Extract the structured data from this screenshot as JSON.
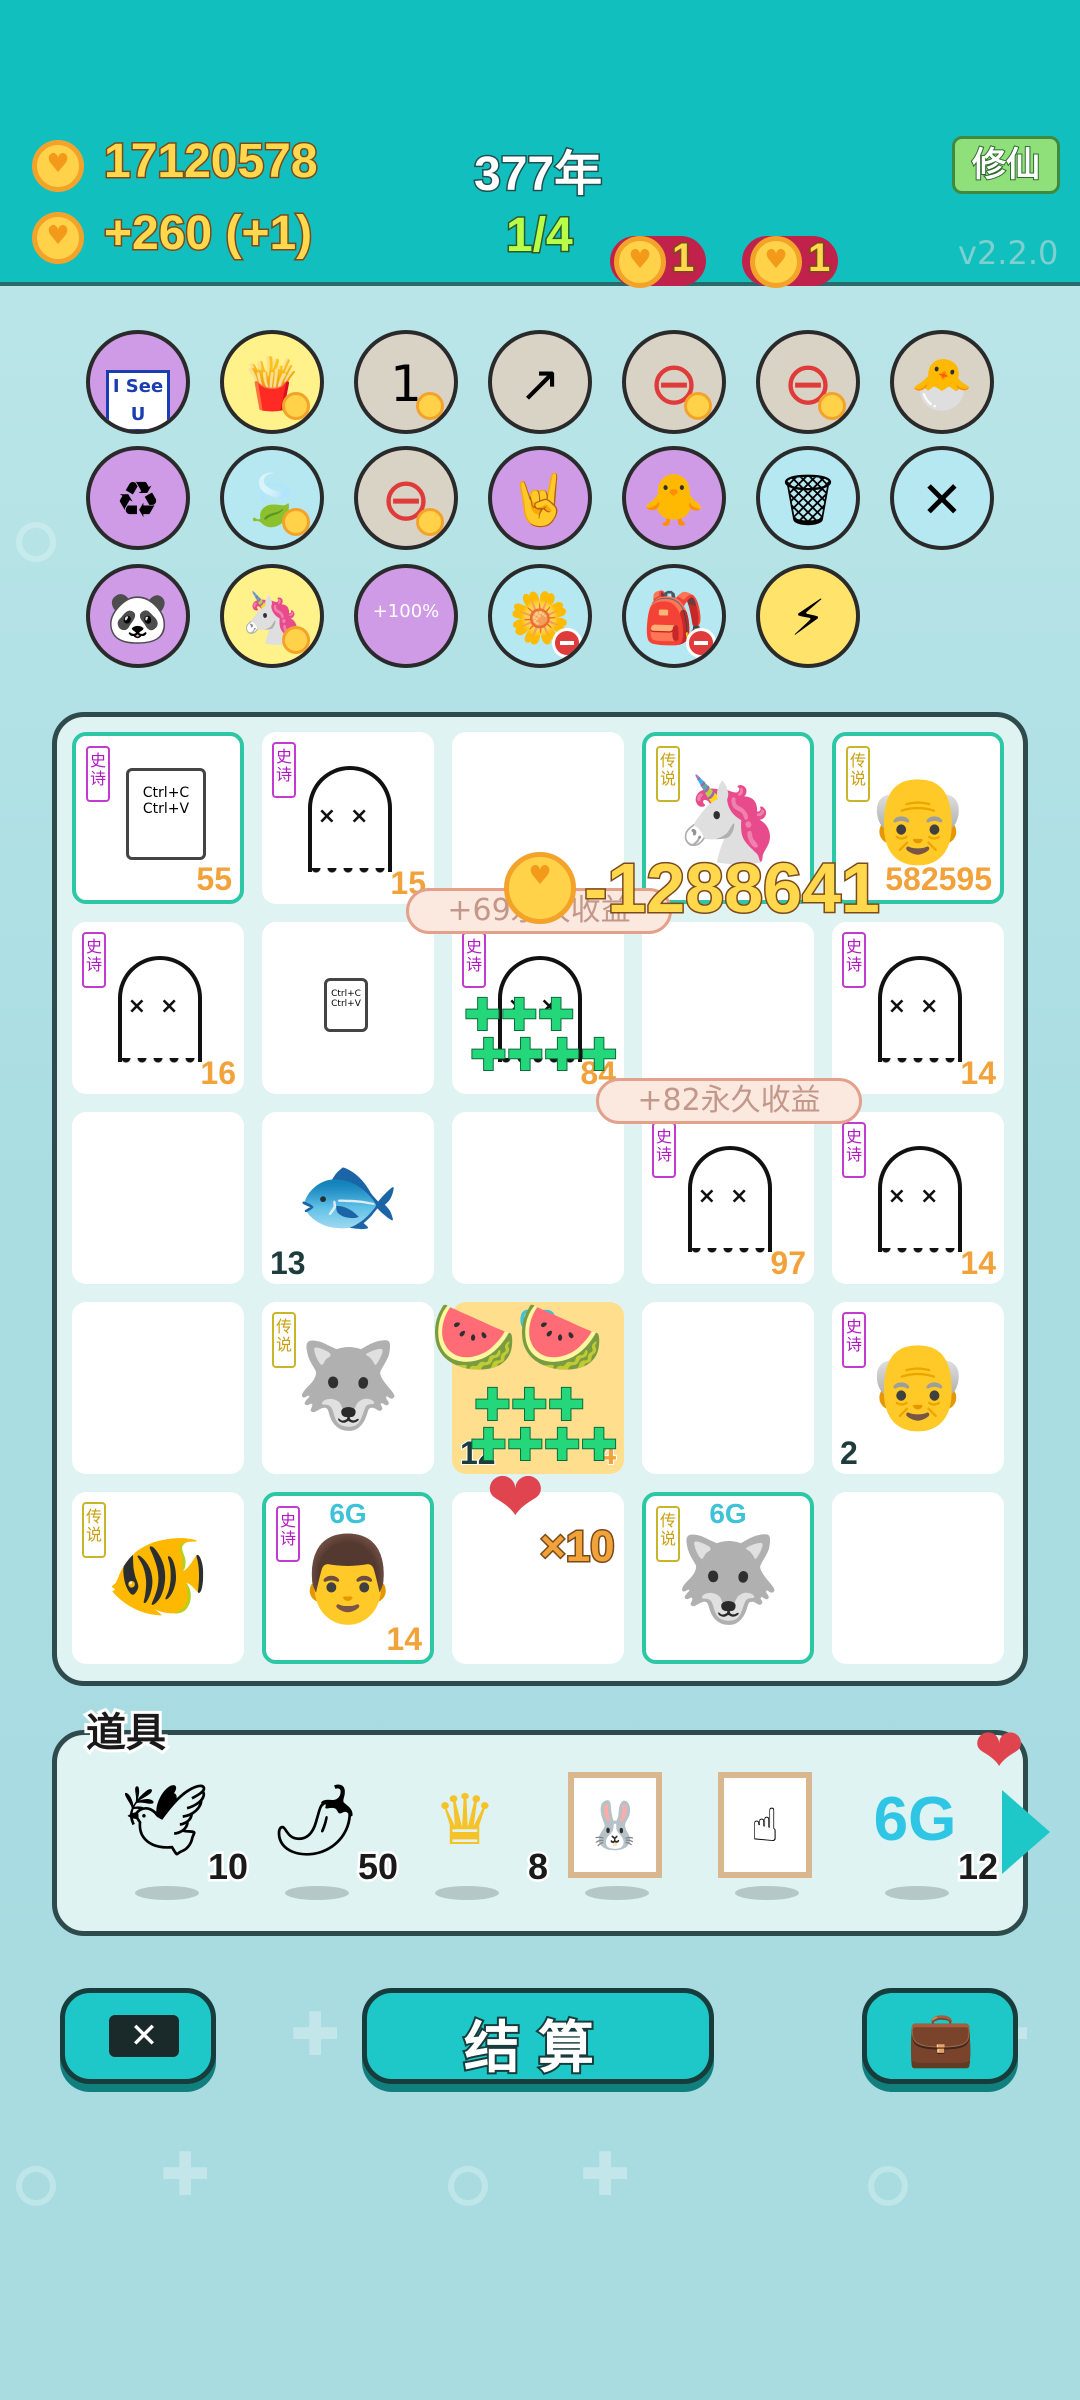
{
  "header": {
    "coins": "17120578",
    "income": "+260 (+1)",
    "years": "377年",
    "progress": "1/4",
    "badge1": "1",
    "badge2": "1",
    "xiuxian_button": "修仙",
    "version": "v2.2.0"
  },
  "skills": [
    {
      "icon": "i-see-u-icon",
      "label": "I See U",
      "color": "#cf9be6"
    },
    {
      "icon": "fries-icon",
      "label": "🍟",
      "color": "#fff28a"
    },
    {
      "icon": "coin-hands-icon",
      "label": "1",
      "color": "#d9d3c6"
    },
    {
      "icon": "arrow-up-icon",
      "label": "↗",
      "color": "#d9d3c6"
    },
    {
      "icon": "no-entry-icon",
      "label": "⊖",
      "color": "#d9d3c6"
    },
    {
      "icon": "no-entry-icon",
      "label": "⊖",
      "color": "#d9d3c6"
    },
    {
      "icon": "chick-egg-icon",
      "label": "🐣",
      "color": "#d9d3c6"
    },
    {
      "icon": "recycle-icon",
      "label": "♻",
      "color": "#cf9be6"
    },
    {
      "icon": "leaf-icon",
      "label": "🍃",
      "color": "#b6e8f2"
    },
    {
      "icon": "no-entry-icon",
      "label": "⊖",
      "color": "#d9d3c6"
    },
    {
      "icon": "rock-hand-icon",
      "label": "🤘",
      "color": "#cf9be6"
    },
    {
      "icon": "chicks-icon",
      "label": "🐥",
      "color": "#cf9be6"
    },
    {
      "icon": "trash-bag-icon",
      "label": "🗑",
      "color": "#b6e8f2"
    },
    {
      "icon": "sticks-icon",
      "label": "✕",
      "color": "#b6e8f2"
    },
    {
      "icon": "panda-icon",
      "label": "🐼",
      "color": "#cf9be6"
    },
    {
      "icon": "unicorn-icon",
      "label": "🦄",
      "color": "#fff28a"
    },
    {
      "icon": "bucket-icon",
      "label": "+100%",
      "color": "#cf9be6"
    },
    {
      "icon": "flower-pot-icon",
      "label": "🌼",
      "color": "#b6e8f2"
    },
    {
      "icon": "bag-icon",
      "label": "🎒",
      "color": "#b6e8f2"
    },
    {
      "icon": "lightning-icon",
      "label": "⚡",
      "color": "#ffe36b"
    }
  ],
  "board": {
    "cells": [
      {
        "tag": "史诗",
        "num": "55"
      },
      {
        "tag": "史诗",
        "num": "15"
      },
      {
        "tag": "",
        "num": ""
      },
      {
        "tag": "传说",
        "num": ""
      },
      {
        "tag": "传说",
        "num": "582595"
      },
      {
        "tag": "史诗",
        "num": "16"
      },
      {
        "tag": "",
        "num": ""
      },
      {
        "tag": "史诗",
        "num": "84"
      },
      {
        "tag": "",
        "num": ""
      },
      {
        "tag": "史诗",
        "num": "14"
      },
      {
        "tag": "",
        "num": ""
      },
      {
        "tag": "",
        "num": "13"
      },
      {
        "tag": "",
        "num": ""
      },
      {
        "tag": "史诗",
        "num": "97"
      },
      {
        "tag": "史诗",
        "num": "14"
      },
      {
        "tag": "",
        "num": ""
      },
      {
        "tag": "传说",
        "num": ""
      },
      {
        "tag": "",
        "num": "12",
        "g6": "6G",
        "num2": "4"
      },
      {
        "tag": "",
        "num": ""
      },
      {
        "tag": "史诗",
        "num": "2"
      },
      {
        "tag": "传说",
        "num": ""
      },
      {
        "tag": "史诗",
        "num": "14",
        "g6": "6G"
      },
      {
        "tag": "",
        "num": ""
      },
      {
        "tag": "传说",
        "num": "",
        "g6": "6G"
      },
      {
        "tag": "",
        "num": ""
      }
    ],
    "ctrl_text": "Ctrl+C\nCtrl+V",
    "loss": "-1288641",
    "bubble1": "+69永久收益",
    "bubble2": "+82永久收益",
    "multiplier": "×10"
  },
  "props": {
    "label": "道具",
    "items": [
      {
        "icon": "dove-icon",
        "count": "10"
      },
      {
        "icon": "chili-icon",
        "count": "50"
      },
      {
        "icon": "crown-icon",
        "count": "8"
      },
      {
        "icon": "rabbit-frame-icon",
        "count": ""
      },
      {
        "icon": "finger-frame-icon",
        "count": ""
      },
      {
        "icon": "6g-icon",
        "count": "12",
        "text": "6G"
      }
    ]
  },
  "buttons": {
    "exit": "exit-icon",
    "settle": "结算",
    "bag": "briefcase-icon"
  }
}
